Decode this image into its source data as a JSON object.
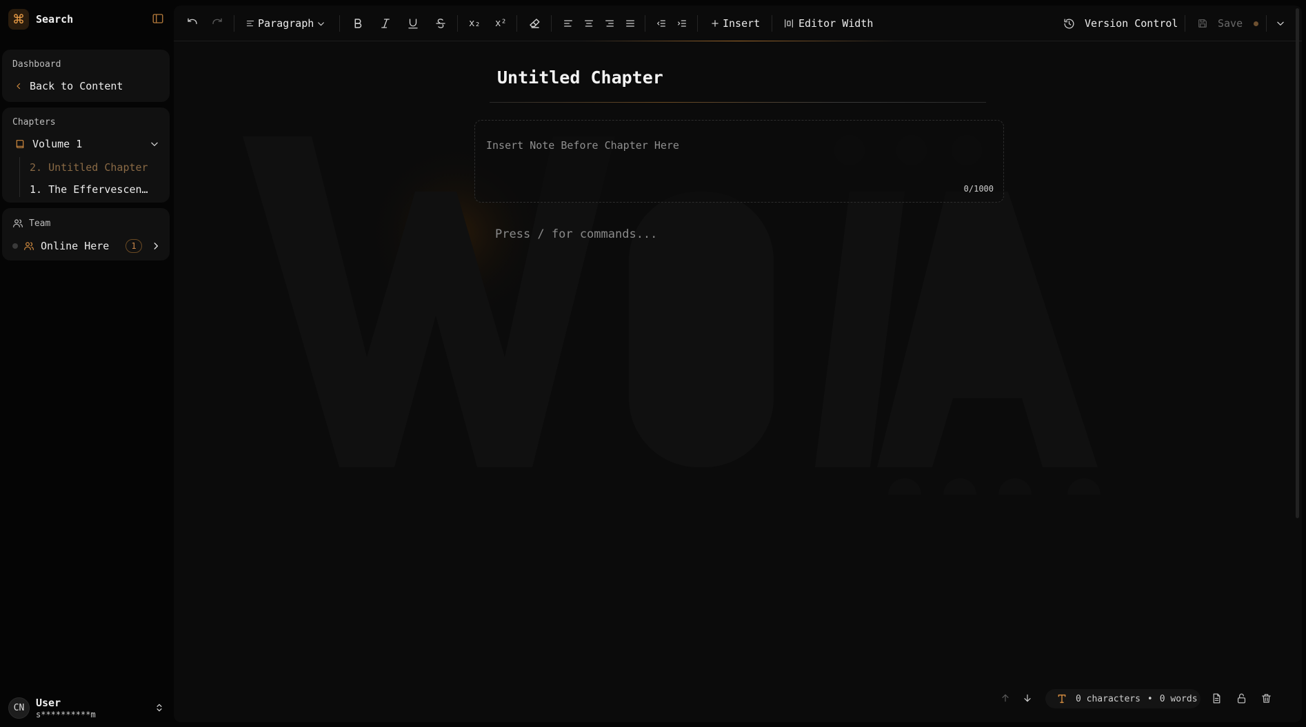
{
  "sidebar": {
    "search_label": "Search",
    "dashboard": {
      "label": "Dashboard",
      "back_label": "Back to Content"
    },
    "chapters": {
      "label": "Chapters",
      "volume_label": "Volume 1",
      "items": [
        {
          "label": "2. Untitled Chapter",
          "active": true
        },
        {
          "label": "1. The Effervescen…",
          "active": false
        }
      ]
    },
    "team": {
      "label": "Team",
      "online_label": "Online Here",
      "online_count": "1"
    },
    "user": {
      "initials": "CN",
      "name": "User",
      "email": "s**********m"
    }
  },
  "toolbar": {
    "paragraph_label": "Paragraph",
    "subscript_label": "x₂",
    "superscript_label": "x²",
    "insert_label": "Insert",
    "editor_width_label": "Editor Width",
    "version_control_label": "Version Control",
    "save_label": "Save"
  },
  "editor": {
    "chapter_title": "Untitled Chapter",
    "note_placeholder": "Insert Note Before Chapter Here",
    "note_count": "0/1000",
    "body_placeholder": "Press / for commands..."
  },
  "status": {
    "characters": "0 characters",
    "separator": "•",
    "words": "0 words"
  },
  "colors": {
    "accent": "#f0a048",
    "background": "#050505",
    "panel": "#0b0b0b",
    "card": "#111111"
  },
  "icons": [
    "command-icon",
    "sidebar-toggle-icon",
    "chevron-left-icon",
    "book-icon",
    "chevron-down-icon",
    "users-icon",
    "chevron-right-icon",
    "undo-icon",
    "redo-icon",
    "align-left-icon",
    "bold-icon",
    "italic-icon",
    "underline-icon",
    "strikethrough-icon",
    "eraser-icon",
    "align-center-icon",
    "align-right-icon",
    "align-justify-icon",
    "outdent-icon",
    "indent-icon",
    "plus-icon",
    "editor-width-icon",
    "history-icon",
    "save-icon",
    "arrow-up-icon",
    "arrow-down-icon",
    "text-icon",
    "document-icon",
    "lock-icon",
    "trash-icon",
    "chevrons-up-down-icon"
  ]
}
